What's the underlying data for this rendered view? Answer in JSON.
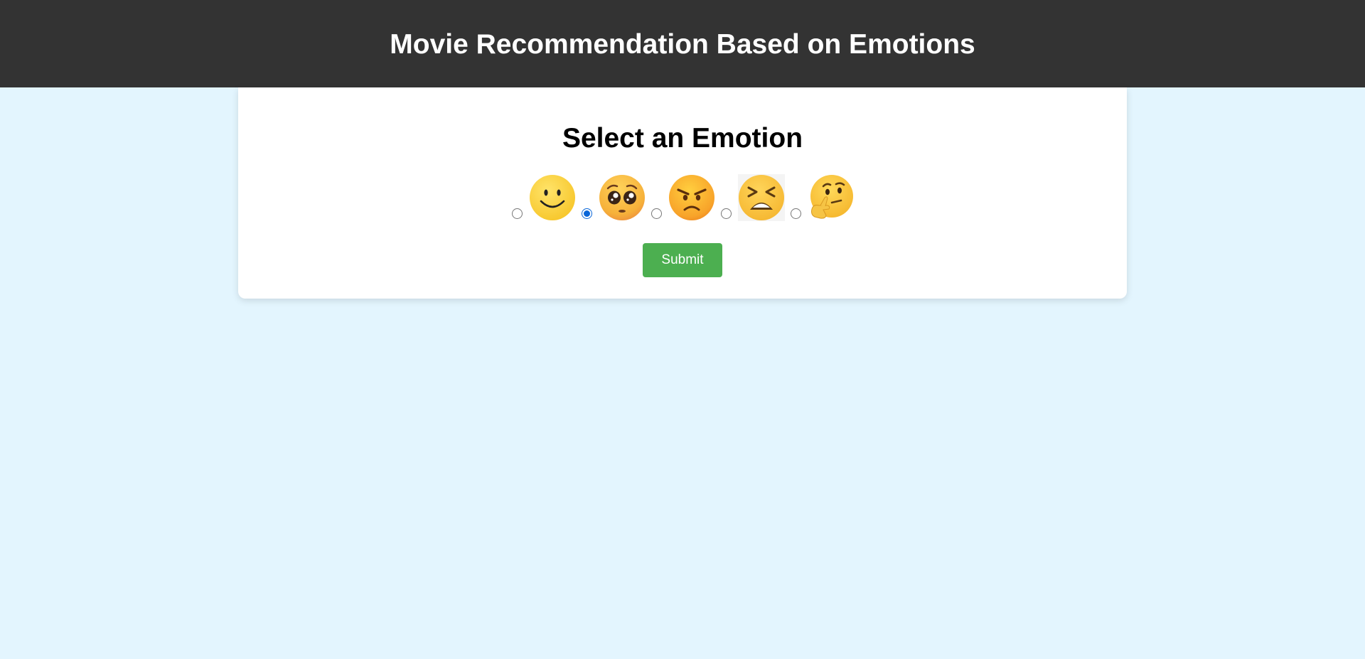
{
  "header": {
    "title": "Movie Recommendation Based on Emotions"
  },
  "card": {
    "heading": "Select an Emotion",
    "emotions": [
      {
        "name": "happy",
        "icon": "slightly-smiling-face",
        "selected": false
      },
      {
        "name": "sad",
        "icon": "pleading-face",
        "selected": true
      },
      {
        "name": "angry",
        "icon": "angry-face",
        "selected": false
      },
      {
        "name": "tired",
        "icon": "tired-face",
        "selected": false
      },
      {
        "name": "thinking",
        "icon": "thinking-face",
        "selected": false
      }
    ],
    "submit_label": "Submit"
  },
  "colors": {
    "header_bg": "#333333",
    "page_bg": "#e3f5fe",
    "button_bg": "#4caf50",
    "emoji_yellow": "#fcd03a"
  }
}
